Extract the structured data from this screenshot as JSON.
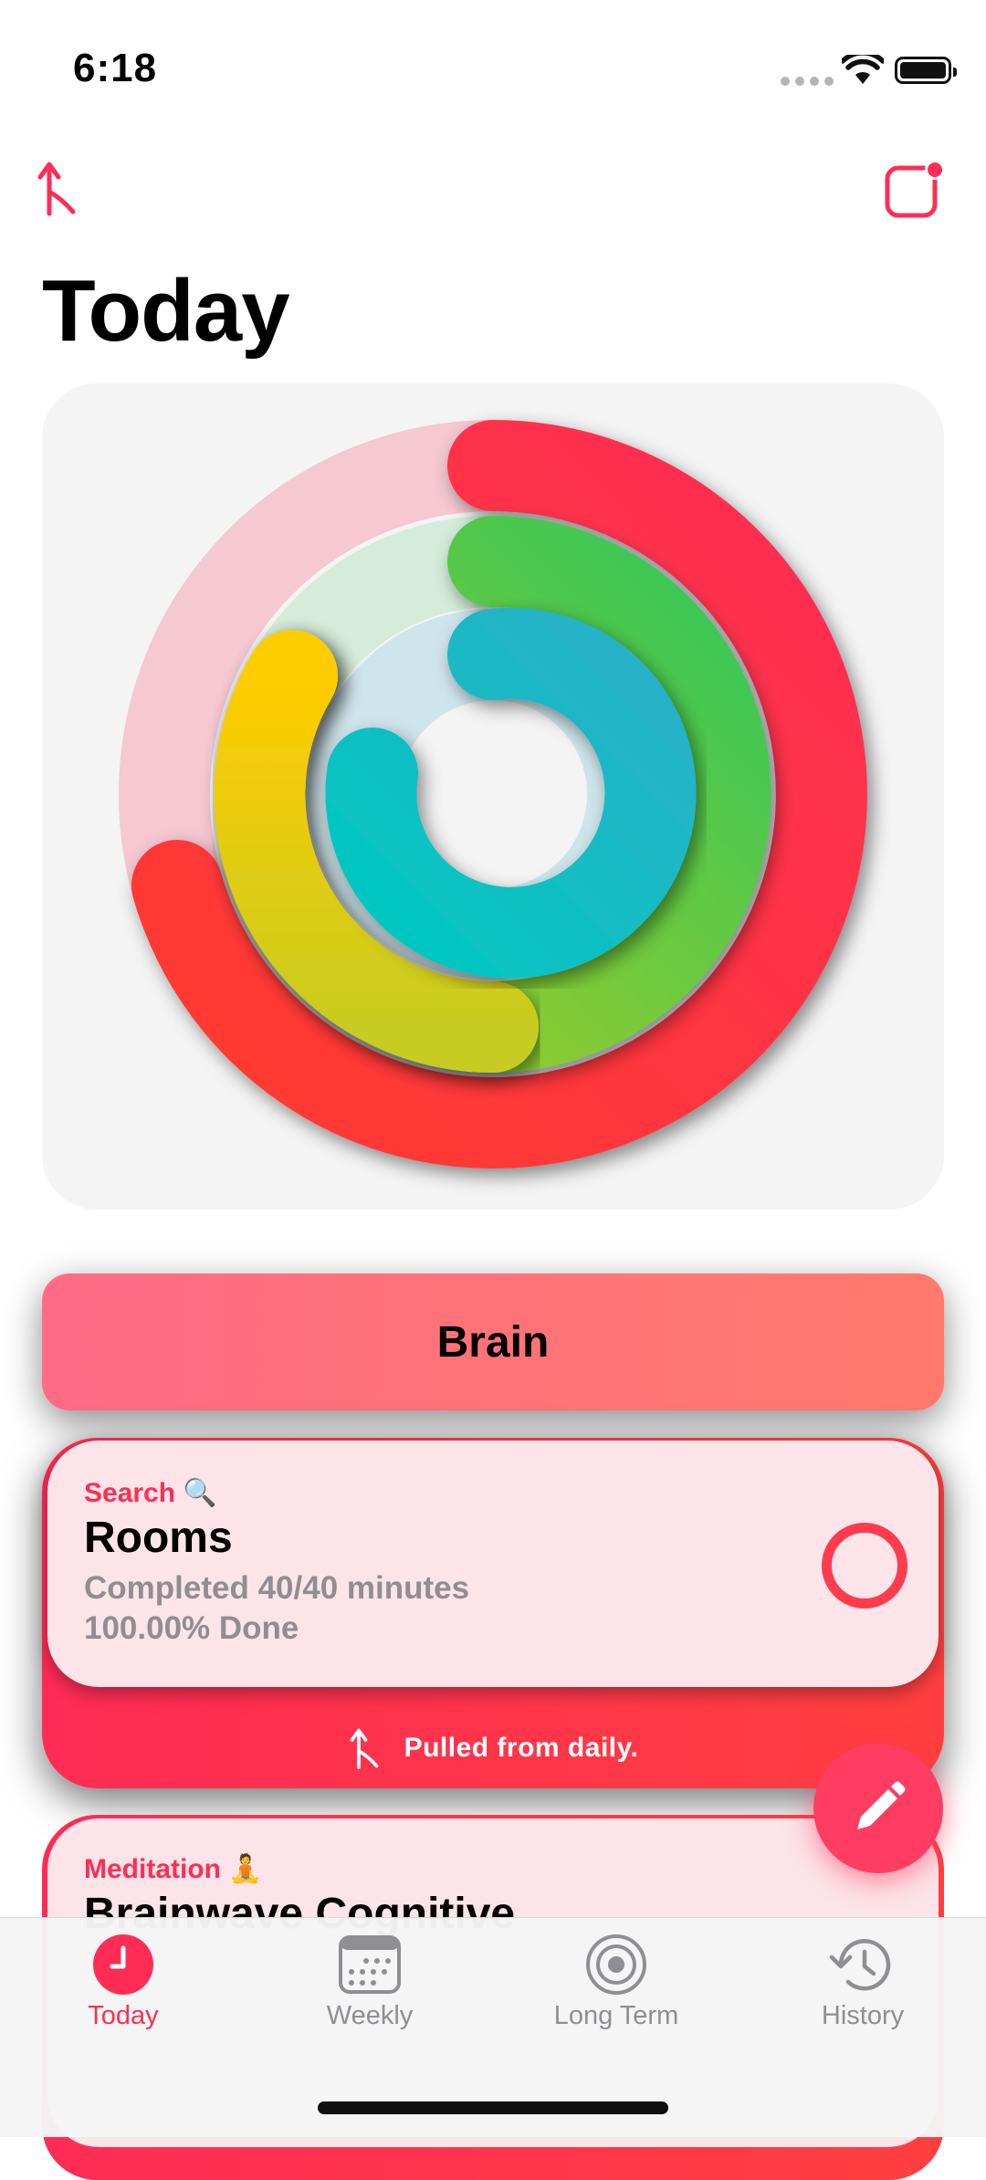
{
  "status_bar": {
    "time": "6:18"
  },
  "page": {
    "title": "Today"
  },
  "colors": {
    "accent": "#ff2d55",
    "ring_outer": "#ff2d55",
    "ring_green": "#34c759",
    "ring_teal": "#2ab0c8",
    "ring_yellow": "#ffcc00"
  },
  "rings": [
    {
      "name": "outer-red",
      "progress": 0.82
    },
    {
      "name": "green",
      "progress": 0.5
    },
    {
      "name": "teal",
      "progress": 0.75
    },
    {
      "name": "yellow-partial",
      "progress": 0.22
    }
  ],
  "section": {
    "label": "Brain"
  },
  "goals": [
    {
      "category": "Search 🔍",
      "title": "Rooms",
      "line1": "Completed 40/40 minutes",
      "line2": "100.00% Done",
      "footer": "Pulled from daily."
    },
    {
      "category": "Meditation 🧘",
      "title": "Brainwave Cognitive"
    }
  ],
  "tabs": [
    {
      "label": "Today",
      "icon": "clock-icon",
      "active": true
    },
    {
      "label": "Weekly",
      "icon": "calendar-icon",
      "active": false
    },
    {
      "label": "Long Term",
      "icon": "target-icon",
      "active": false
    },
    {
      "label": "History",
      "icon": "history-icon",
      "active": false
    }
  ]
}
